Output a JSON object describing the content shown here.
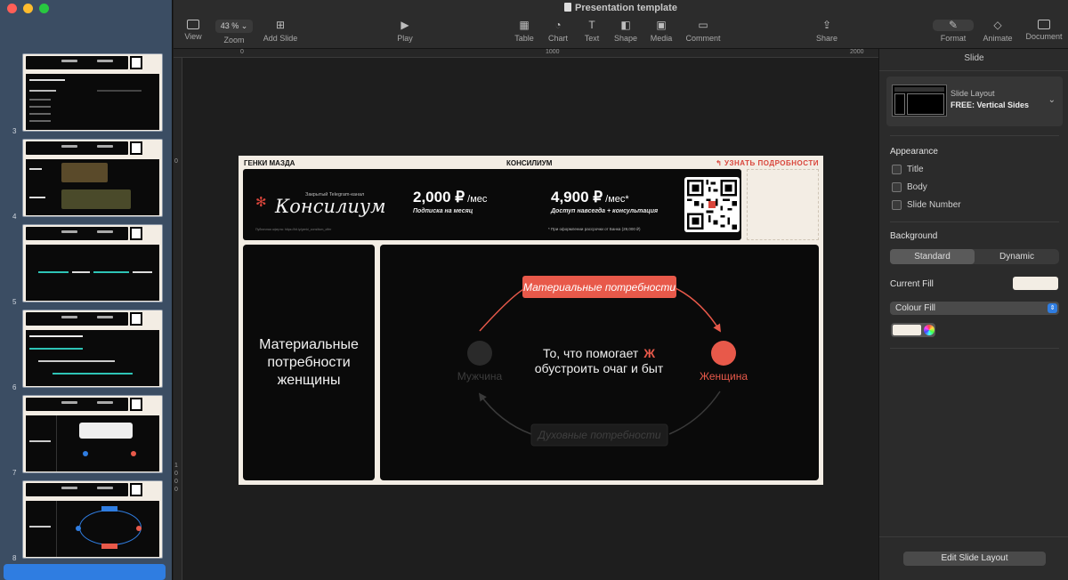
{
  "window": {
    "title": "Presentation template"
  },
  "toolbar": {
    "view": "View",
    "zoom_value": "43 %",
    "zoom": "Zoom",
    "add_slide": "Add Slide",
    "play": "Play",
    "table": "Table",
    "chart": "Chart",
    "text": "Text",
    "shape": "Shape",
    "media": "Media",
    "comment": "Comment",
    "share": "Share",
    "format": "Format",
    "animate": "Animate",
    "document": "Document"
  },
  "ruler": {
    "h": [
      "0",
      "1000",
      "2000"
    ],
    "v": [
      "0",
      "1",
      "0",
      "0",
      "0"
    ]
  },
  "slide_navigator": {
    "numbers": [
      "3",
      "4",
      "5",
      "6",
      "7",
      "8"
    ]
  },
  "slide": {
    "header_left": "ГЕНКИ МАЗДА",
    "header_center": "КОНСИЛИУМ",
    "header_right": "УЗНАТЬ ПОДРОБНОСТИ",
    "brand_small": "Закрытый Telegram-канал",
    "brand_name": "Консилиум",
    "brand_fine": "Публичная оферта: https://bit.ly/genki_consilium_offer",
    "price1": "2,000 ₽",
    "price1_unit": " /мес",
    "price1_sub": "Подписка на месяц",
    "price2": "4,900 ₽",
    "price2_unit": " /мес*",
    "price2_sub": "Доступ навсегда + консультация",
    "price_note": "* При оформлении рассрочки от Банка (29,000 ₽)",
    "left_panel_lines": [
      "Материальные",
      "потребности",
      "женщины"
    ],
    "diagram": {
      "top_label": "Материальные потребности",
      "bottom_label": "Духовные потребности",
      "left_node": "Мужчина",
      "right_node": "Женщина",
      "center_line1": "То, что помогает",
      "center_mark": "Ж",
      "center_line2": "обустроить очаг и быт"
    }
  },
  "inspector": {
    "title": "Slide",
    "layout_label": "Slide Layout",
    "layout_value": "FREE: Vertical Sides",
    "appearance": "Appearance",
    "appearance_items": [
      "Title",
      "Body",
      "Slide Number"
    ],
    "background": "Background",
    "bg_modes": [
      "Standard",
      "Dynamic"
    ],
    "current_fill": "Current Fill",
    "fill_type": "Colour Fill",
    "edit_layout": "Edit Slide Layout"
  },
  "colors": {
    "accent": "#e8594a",
    "slide_bg": "#f3ede4",
    "dark": "#0a0a0a",
    "teal": "#2ec4b6",
    "selection": "#2f7de1"
  }
}
